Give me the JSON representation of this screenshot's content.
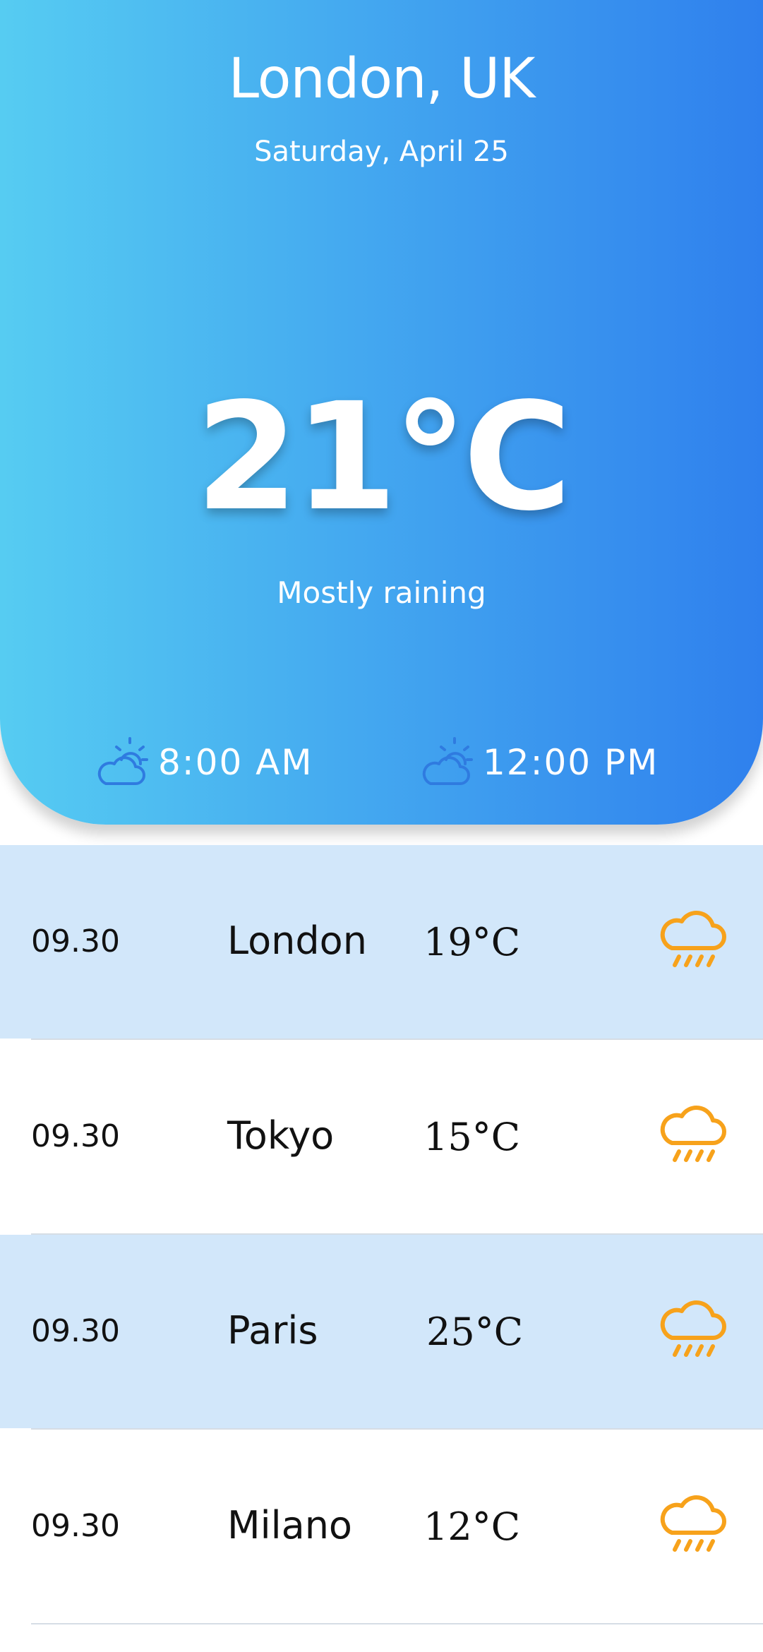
{
  "header": {
    "location": "London, UK",
    "date": "Saturday, April 25",
    "temperature": "21°C",
    "condition": "Mostly raining",
    "hours": [
      {
        "time": "8:00 AM",
        "icon": "partly-cloudy-icon"
      },
      {
        "time": "12:00 PM",
        "icon": "partly-cloudy-icon"
      }
    ]
  },
  "forecast": [
    {
      "time": "09.30",
      "city": "London",
      "temp": "19°C",
      "icon": "rain-icon"
    },
    {
      "time": "09.30",
      "city": "Tokyo",
      "temp": "15°C",
      "icon": "rain-icon"
    },
    {
      "time": "09.30",
      "city": "Paris",
      "temp": "25°C",
      "icon": "rain-icon"
    },
    {
      "time": "09.30",
      "city": "Milano",
      "temp": "12°C",
      "icon": "rain-icon"
    }
  ],
  "colors": {
    "gradient_start": "#56ccf2",
    "gradient_end": "#2f80ed",
    "row_highlight": "#d2e7fa",
    "rain_icon": "#f7a21b",
    "hour_icon": "#2f7be0"
  }
}
